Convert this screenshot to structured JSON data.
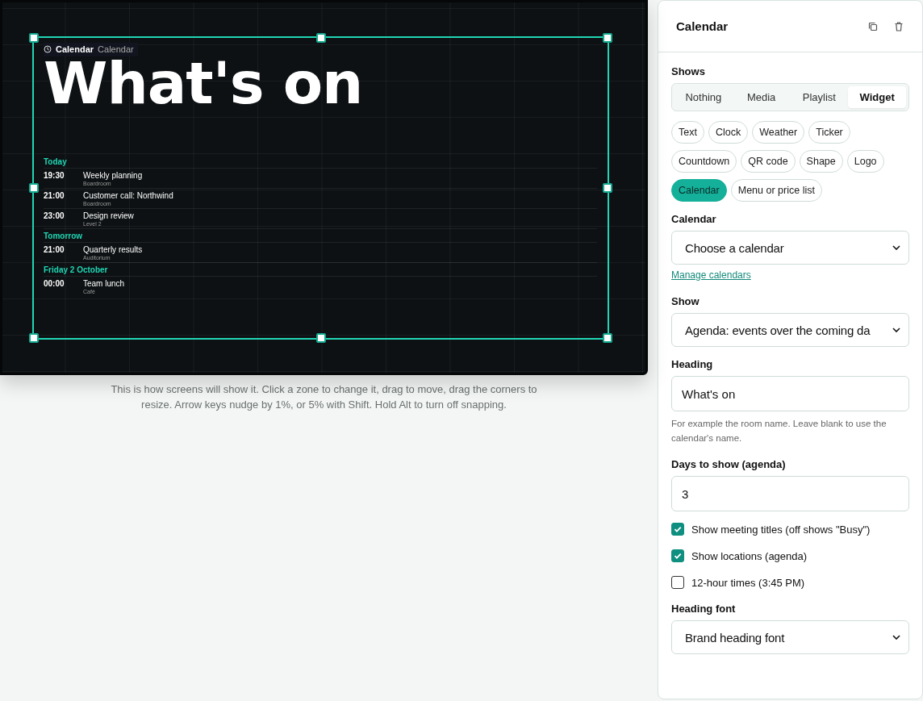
{
  "preview": {
    "zone_tag": {
      "title": "Calendar",
      "subtitle": "Calendar"
    },
    "heading": "What's on",
    "agenda": [
      {
        "day": "Today",
        "events": [
          {
            "time": "19:30",
            "title": "Weekly planning",
            "location": "Boardroom"
          },
          {
            "time": "21:00",
            "title": "Customer call: Northwind",
            "location": "Boardroom"
          },
          {
            "time": "23:00",
            "title": "Design review",
            "location": "Level 2"
          }
        ]
      },
      {
        "day": "Tomorrow",
        "events": [
          {
            "time": "21:00",
            "title": "Quarterly results",
            "location": "Auditorium"
          }
        ]
      },
      {
        "day": "Friday 2 October",
        "events": [
          {
            "time": "00:00",
            "title": "Team lunch",
            "location": "Café"
          }
        ]
      }
    ]
  },
  "caption": "This is how screens will show it. Click a zone to change it, drag to move, drag the corners to resize. Arrow keys nudge by 1%, or 5% with Shift. Hold Alt to turn off snapping.",
  "panel": {
    "title": "Calendar",
    "shows": {
      "label": "Shows",
      "tabs": [
        {
          "label": "Nothing",
          "selected": false
        },
        {
          "label": "Media",
          "selected": false
        },
        {
          "label": "Playlist",
          "selected": false
        },
        {
          "label": "Widget",
          "selected": true
        }
      ]
    },
    "widgets": [
      {
        "label": "Text",
        "selected": false
      },
      {
        "label": "Clock",
        "selected": false
      },
      {
        "label": "Weather",
        "selected": false
      },
      {
        "label": "Ticker",
        "selected": false
      },
      {
        "label": "Countdown",
        "selected": false
      },
      {
        "label": "QR code",
        "selected": false
      },
      {
        "label": "Shape",
        "selected": false
      },
      {
        "label": "Logo",
        "selected": false
      },
      {
        "label": "Calendar",
        "selected": true
      },
      {
        "label": "Menu or price list",
        "selected": false
      }
    ],
    "form": [
      {
        "kind": "label",
        "text": "Calendar"
      },
      {
        "kind": "select",
        "value": "Choose a calendar"
      },
      {
        "kind": "link",
        "text": "Manage calendars"
      },
      {
        "kind": "label",
        "text": "Show"
      },
      {
        "kind": "select",
        "value": "Agenda: events over the coming da"
      },
      {
        "kind": "label",
        "text": "Heading"
      },
      {
        "kind": "input",
        "value": "What's on"
      },
      {
        "kind": "hint",
        "text": "For example the room name. Leave blank to use the calendar's name."
      },
      {
        "kind": "label",
        "text": "Days to show (agenda)"
      },
      {
        "kind": "input",
        "value": "3"
      },
      {
        "kind": "checkbox",
        "text": "Show meeting titles (off shows \"Busy\")",
        "checked": true
      },
      {
        "kind": "checkbox",
        "text": "Show locations (agenda)",
        "checked": true
      },
      {
        "kind": "checkbox",
        "text": "12-hour times (3:45 PM)",
        "checked": false
      },
      {
        "kind": "label",
        "text": "Heading font"
      },
      {
        "kind": "select",
        "value": "Brand heading font"
      }
    ]
  }
}
